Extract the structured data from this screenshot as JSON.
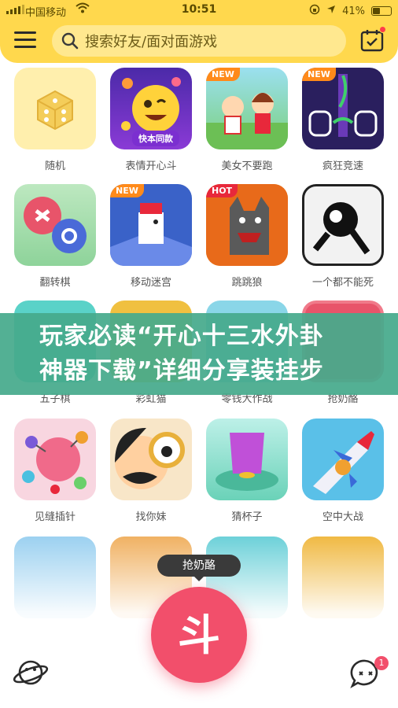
{
  "status_bar": {
    "carrier": "中国移动",
    "time": "10:51",
    "battery_text": "41%",
    "battery_level": 0.41
  },
  "header": {
    "search_placeholder": "搜索好友/面对面游戏"
  },
  "games": [
    {
      "label": "随机",
      "icon": "dice-icon"
    },
    {
      "label": "表情开心斗",
      "icon": "emoji-face-icon",
      "tag": "快本同款"
    },
    {
      "label": "美女不要跑",
      "icon": "chase-girl-icon",
      "badge": "NEW"
    },
    {
      "label": "疯狂竞速",
      "icon": "tap-hands-icon",
      "badge": "NEW"
    },
    {
      "label": "翻转棋",
      "icon": "flip-chess-icon"
    },
    {
      "label": "移动迷宫",
      "icon": "maze-dog-icon",
      "badge": "NEW"
    },
    {
      "label": "跳跳狼",
      "icon": "wolf-icon",
      "badge": "HOT"
    },
    {
      "label": "一个都不能死",
      "icon": "stickman-icon"
    },
    {
      "label": "五子棋",
      "icon": "gomoku-icon"
    },
    {
      "label": "彩虹猫",
      "icon": "rainbow-cat-icon"
    },
    {
      "label": "零钱大作战",
      "icon": "coins-icon"
    },
    {
      "label": "抢奶酪",
      "icon": "cheese-icon"
    },
    {
      "label": "见缝插针",
      "icon": "pin-balls-icon"
    },
    {
      "label": "找你妹",
      "icon": "magnifier-face-icon"
    },
    {
      "label": "猜杯子",
      "icon": "cup-icon"
    },
    {
      "label": "空中大战",
      "icon": "plane-icon"
    },
    {
      "label": "",
      "icon": "whale-icon"
    },
    {
      "label": "",
      "icon": "fruit-icon"
    },
    {
      "label": "",
      "icon": "ocean-icon"
    },
    {
      "label": "",
      "icon": "tiles-icon"
    }
  ],
  "banner": {
    "line1": "玩家必读“开心十三水外卦",
    "line2": "神器下载”详细分享装挂步"
  },
  "tooltip": "抢奶酪",
  "fab_glyph": "斗",
  "chat_count": "1",
  "colors": {
    "accent": "#ffd84d",
    "fab": "#f24f6b",
    "banner": "#46aa8c"
  }
}
